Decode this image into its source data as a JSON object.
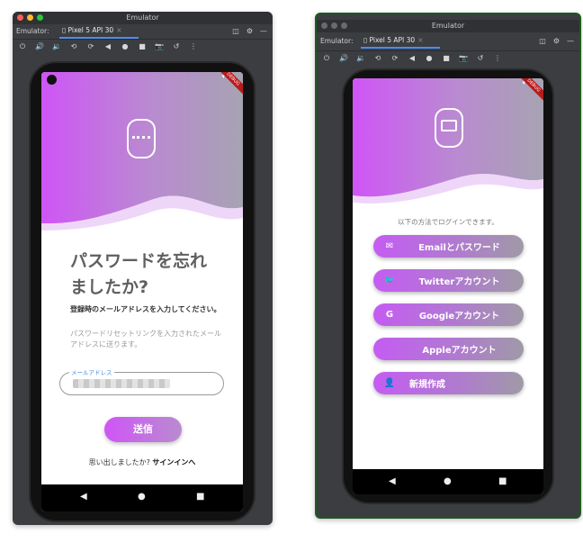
{
  "left_window": {
    "title": "Emulator",
    "tab_label": "Emulator:",
    "device_tab": "Pixel 5 API 30",
    "app": {
      "heading": "パスワードを忘れましたか?",
      "subtitle": "登録時のメールアドレスを入力してください。",
      "description": "パスワードリセットリンクを入力されたメールアドレスに送ります。",
      "email_label": "メールアドレス",
      "email_value": "",
      "submit": "送信",
      "signin_prompt": "思い出しましたか?",
      "signin_link": "サインインへ",
      "debug_banner": "DEBUG"
    }
  },
  "right_window": {
    "title": "Emulator",
    "tab_label": "Emulator:",
    "device_tab": "Pixel 5 API 30",
    "app": {
      "intro": "以下の方法でログインできます。",
      "buttons": [
        {
          "label": "Emailとパスワード",
          "icon": "mail-icon"
        },
        {
          "label": "Twitterアカウント",
          "icon": "twitter-icon"
        },
        {
          "label": "Googleアカウント",
          "icon": "google-icon"
        },
        {
          "label": "Appleアカウント",
          "icon": "apple-icon"
        },
        {
          "label": "新規作成",
          "icon": "add-person-icon"
        }
      ],
      "debug_banner": "DEBUG"
    }
  },
  "colors": {
    "gradient_start": "#c55cf3",
    "gradient_end": "#a3a0ad",
    "link_blue": "#3d8de0"
  }
}
